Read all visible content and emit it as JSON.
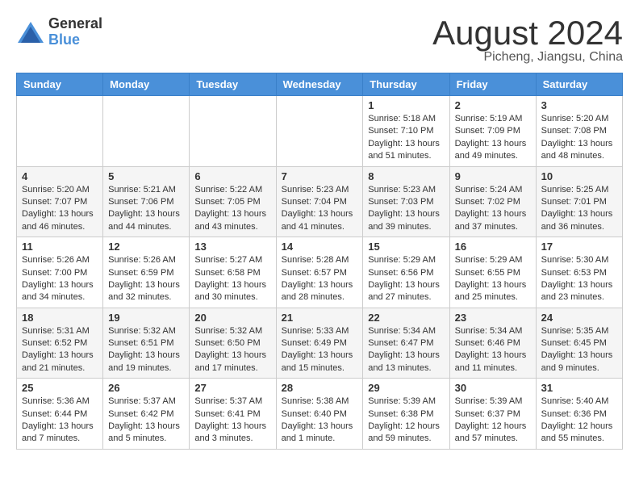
{
  "header": {
    "logo_general": "General",
    "logo_blue": "Blue",
    "title": "August 2024",
    "location": "Picheng, Jiangsu, China"
  },
  "weekdays": [
    "Sunday",
    "Monday",
    "Tuesday",
    "Wednesday",
    "Thursday",
    "Friday",
    "Saturday"
  ],
  "weeks": [
    [
      {
        "day": "",
        "content": ""
      },
      {
        "day": "",
        "content": ""
      },
      {
        "day": "",
        "content": ""
      },
      {
        "day": "",
        "content": ""
      },
      {
        "day": "1",
        "content": "Sunrise: 5:18 AM\nSunset: 7:10 PM\nDaylight: 13 hours\nand 51 minutes."
      },
      {
        "day": "2",
        "content": "Sunrise: 5:19 AM\nSunset: 7:09 PM\nDaylight: 13 hours\nand 49 minutes."
      },
      {
        "day": "3",
        "content": "Sunrise: 5:20 AM\nSunset: 7:08 PM\nDaylight: 13 hours\nand 48 minutes."
      }
    ],
    [
      {
        "day": "4",
        "content": "Sunrise: 5:20 AM\nSunset: 7:07 PM\nDaylight: 13 hours\nand 46 minutes."
      },
      {
        "day": "5",
        "content": "Sunrise: 5:21 AM\nSunset: 7:06 PM\nDaylight: 13 hours\nand 44 minutes."
      },
      {
        "day": "6",
        "content": "Sunrise: 5:22 AM\nSunset: 7:05 PM\nDaylight: 13 hours\nand 43 minutes."
      },
      {
        "day": "7",
        "content": "Sunrise: 5:23 AM\nSunset: 7:04 PM\nDaylight: 13 hours\nand 41 minutes."
      },
      {
        "day": "8",
        "content": "Sunrise: 5:23 AM\nSunset: 7:03 PM\nDaylight: 13 hours\nand 39 minutes."
      },
      {
        "day": "9",
        "content": "Sunrise: 5:24 AM\nSunset: 7:02 PM\nDaylight: 13 hours\nand 37 minutes."
      },
      {
        "day": "10",
        "content": "Sunrise: 5:25 AM\nSunset: 7:01 PM\nDaylight: 13 hours\nand 36 minutes."
      }
    ],
    [
      {
        "day": "11",
        "content": "Sunrise: 5:26 AM\nSunset: 7:00 PM\nDaylight: 13 hours\nand 34 minutes."
      },
      {
        "day": "12",
        "content": "Sunrise: 5:26 AM\nSunset: 6:59 PM\nDaylight: 13 hours\nand 32 minutes."
      },
      {
        "day": "13",
        "content": "Sunrise: 5:27 AM\nSunset: 6:58 PM\nDaylight: 13 hours\nand 30 minutes."
      },
      {
        "day": "14",
        "content": "Sunrise: 5:28 AM\nSunset: 6:57 PM\nDaylight: 13 hours\nand 28 minutes."
      },
      {
        "day": "15",
        "content": "Sunrise: 5:29 AM\nSunset: 6:56 PM\nDaylight: 13 hours\nand 27 minutes."
      },
      {
        "day": "16",
        "content": "Sunrise: 5:29 AM\nSunset: 6:55 PM\nDaylight: 13 hours\nand 25 minutes."
      },
      {
        "day": "17",
        "content": "Sunrise: 5:30 AM\nSunset: 6:53 PM\nDaylight: 13 hours\nand 23 minutes."
      }
    ],
    [
      {
        "day": "18",
        "content": "Sunrise: 5:31 AM\nSunset: 6:52 PM\nDaylight: 13 hours\nand 21 minutes."
      },
      {
        "day": "19",
        "content": "Sunrise: 5:32 AM\nSunset: 6:51 PM\nDaylight: 13 hours\nand 19 minutes."
      },
      {
        "day": "20",
        "content": "Sunrise: 5:32 AM\nSunset: 6:50 PM\nDaylight: 13 hours\nand 17 minutes."
      },
      {
        "day": "21",
        "content": "Sunrise: 5:33 AM\nSunset: 6:49 PM\nDaylight: 13 hours\nand 15 minutes."
      },
      {
        "day": "22",
        "content": "Sunrise: 5:34 AM\nSunset: 6:47 PM\nDaylight: 13 hours\nand 13 minutes."
      },
      {
        "day": "23",
        "content": "Sunrise: 5:34 AM\nSunset: 6:46 PM\nDaylight: 13 hours\nand 11 minutes."
      },
      {
        "day": "24",
        "content": "Sunrise: 5:35 AM\nSunset: 6:45 PM\nDaylight: 13 hours\nand 9 minutes."
      }
    ],
    [
      {
        "day": "25",
        "content": "Sunrise: 5:36 AM\nSunset: 6:44 PM\nDaylight: 13 hours\nand 7 minutes."
      },
      {
        "day": "26",
        "content": "Sunrise: 5:37 AM\nSunset: 6:42 PM\nDaylight: 13 hours\nand 5 minutes."
      },
      {
        "day": "27",
        "content": "Sunrise: 5:37 AM\nSunset: 6:41 PM\nDaylight: 13 hours\nand 3 minutes."
      },
      {
        "day": "28",
        "content": "Sunrise: 5:38 AM\nSunset: 6:40 PM\nDaylight: 13 hours\nand 1 minute."
      },
      {
        "day": "29",
        "content": "Sunrise: 5:39 AM\nSunset: 6:38 PM\nDaylight: 12 hours\nand 59 minutes."
      },
      {
        "day": "30",
        "content": "Sunrise: 5:39 AM\nSunset: 6:37 PM\nDaylight: 12 hours\nand 57 minutes."
      },
      {
        "day": "31",
        "content": "Sunrise: 5:40 AM\nSunset: 6:36 PM\nDaylight: 12 hours\nand 55 minutes."
      }
    ]
  ]
}
